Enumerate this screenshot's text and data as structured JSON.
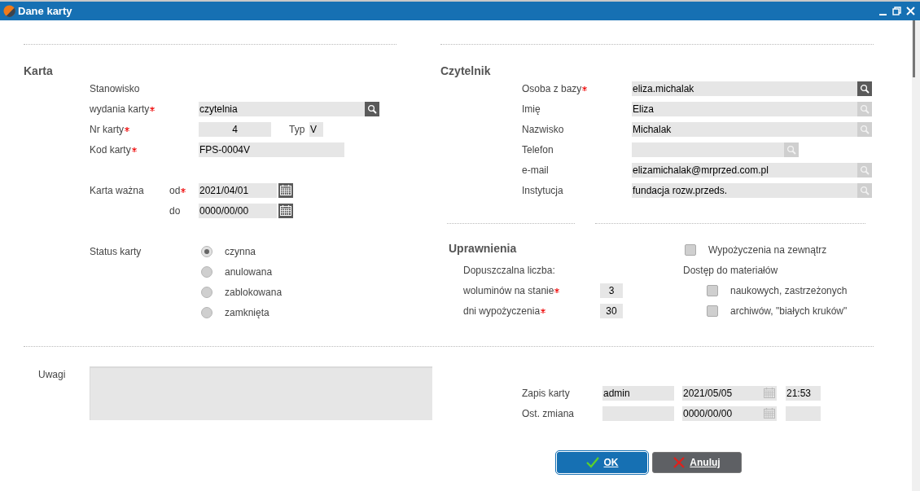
{
  "window": {
    "title": "Dane karty"
  },
  "karta": {
    "heading": "Karta",
    "station_label": "Stanowisko",
    "station": {
      "label": "wydania karty",
      "required": true,
      "value": "czytelnia"
    },
    "card_number": {
      "label": "Nr karty",
      "required": true,
      "value": "4"
    },
    "type": {
      "label": "Typ",
      "value": "V"
    },
    "card_code": {
      "label": "Kod karty",
      "required": true,
      "value": "FPS-0004V"
    },
    "valid_label": "Karta ważna",
    "valid": [
      {
        "label": "od",
        "required": true,
        "value": "2021/04/01"
      },
      {
        "label": "do",
        "required": false,
        "value": "0000/00/00"
      }
    ],
    "status": {
      "label": "Status karty",
      "options": [
        {
          "label": "czynna",
          "selected": true
        },
        {
          "label": "anulowana",
          "selected": false
        },
        {
          "label": "zablokowana",
          "selected": false
        },
        {
          "label": "zamknięta",
          "selected": false
        }
      ]
    }
  },
  "czytelnik": {
    "heading": "Czytelnik",
    "fields": [
      {
        "label": "Osoba z bazy",
        "required": true,
        "value": "eliza.michalak",
        "kind": "long",
        "disabled": false
      },
      {
        "label": "Imię",
        "required": false,
        "value": "Eliza",
        "kind": "long",
        "disabled": true
      },
      {
        "label": "Nazwisko",
        "required": false,
        "value": "Michalak",
        "kind": "long",
        "disabled": true
      },
      {
        "label": "Telefon",
        "required": false,
        "kind": "short",
        "disabled": true
      },
      {
        "label": "e-mail",
        "required": false,
        "value": "elizamichalak@mrprzed.com.pl",
        "kind": "long",
        "disabled": true
      },
      {
        "label": "Instytucja",
        "required": false,
        "value": "fundacja rozw.przeds.",
        "kind": "long",
        "disabled": true
      }
    ]
  },
  "uprawnienia": {
    "heading": "Uprawnienia",
    "count_label": "Dopuszczalna liczba:",
    "limits": [
      {
        "label": "woluminów na stanie",
        "required": true,
        "value": "3"
      },
      {
        "label": "dni wypożyczenia",
        "required": true,
        "value": "30"
      }
    ],
    "external_loans": {
      "label": "Wypożyczenia na zewnątrz",
      "checked": false
    },
    "access_label": "Dostęp do materiałów",
    "access": [
      {
        "label": "naukowych, zastrzeżonych",
        "checked": false
      },
      {
        "label": "archiwów, \"białych kruków\"",
        "checked": false
      }
    ]
  },
  "uwagi": {
    "label": "Uwagi"
  },
  "record": [
    {
      "label": "Zapis karty",
      "user": "admin",
      "date": "2021/05/05",
      "time": "21:53"
    },
    {
      "label": "Ost. zmiana",
      "date": "0000/00/00"
    }
  ],
  "buttons": [
    {
      "label": "OK",
      "kind": "ok",
      "focused": true
    },
    {
      "label": "Anuluj",
      "kind": "cancel",
      "focused": false
    }
  ]
}
